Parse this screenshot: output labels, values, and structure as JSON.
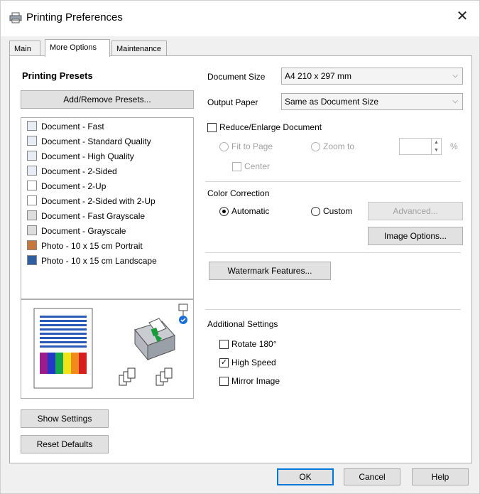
{
  "window": {
    "title": "Printing Preferences"
  },
  "tabs": [
    {
      "label": "Main"
    },
    {
      "label": "More Options"
    },
    {
      "label": "Maintenance"
    }
  ],
  "presets": {
    "heading": "Printing Presets",
    "add_remove_button": "Add/Remove Presets...",
    "items": [
      {
        "label": "Document - Fast",
        "icon": "document-icon"
      },
      {
        "label": "Document - Standard Quality",
        "icon": "document-icon"
      },
      {
        "label": "Document - High Quality",
        "icon": "document-icon"
      },
      {
        "label": "Document - 2-Sided",
        "icon": "two-sided-icon"
      },
      {
        "label": "Document - 2-Up",
        "icon": "two-up-icon"
      },
      {
        "label": "Document - 2-Sided with 2-Up",
        "icon": "two-up-icon"
      },
      {
        "label": "Document - Fast Grayscale",
        "icon": "document-icon"
      },
      {
        "label": "Document - Grayscale",
        "icon": "document-icon"
      },
      {
        "label": "Photo - 10 x 15 cm Portrait",
        "icon": "photo-icon"
      },
      {
        "label": "Photo - 10 x 15 cm Landscape",
        "icon": "photo-icon"
      }
    ]
  },
  "left_buttons": {
    "show_settings": "Show Settings",
    "reset_defaults": "Reset Defaults"
  },
  "document_size": {
    "label": "Document Size",
    "value": "A4 210 x 297 mm"
  },
  "output_paper": {
    "label": "Output Paper",
    "value": "Same as Document Size"
  },
  "reduce_enlarge": {
    "label": "Reduce/Enlarge Document",
    "checked": false,
    "fit_to_page": "Fit to Page",
    "zoom_to": "Zoom to",
    "center": "Center",
    "percent_unit": "%",
    "zoom_value": ""
  },
  "color_correction": {
    "label": "Color Correction",
    "automatic": "Automatic",
    "custom": "Custom",
    "selected": "Automatic",
    "advanced_button": "Advanced...",
    "image_options_button": "Image Options..."
  },
  "watermark_button": "Watermark Features...",
  "additional_settings": {
    "label": "Additional Settings",
    "rotate": {
      "label": "Rotate 180°",
      "checked": false
    },
    "high_speed": {
      "label": "High Speed",
      "checked": true
    },
    "mirror": {
      "label": "Mirror Image",
      "checked": false
    }
  },
  "footer": {
    "ok": "OK",
    "cancel": "Cancel",
    "help": "Help"
  },
  "colors": {
    "accent": "#0078d7",
    "panel_bg": "#f0f0f0",
    "button_bg": "#e1e1e1"
  }
}
